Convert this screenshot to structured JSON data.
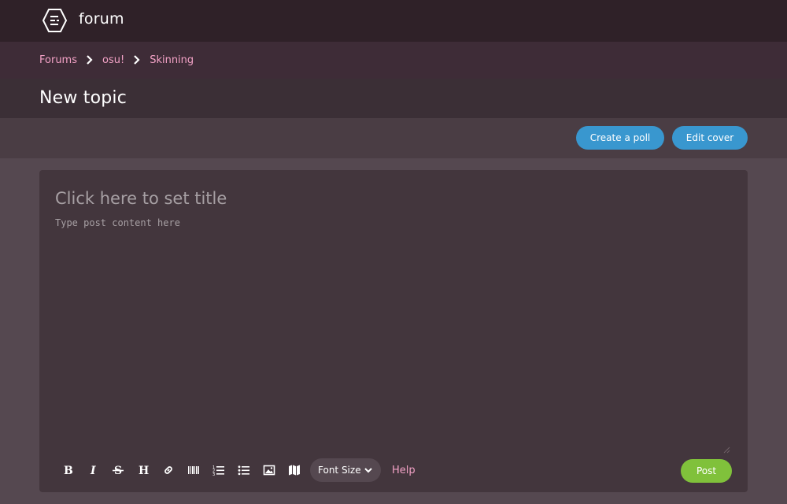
{
  "header": {
    "logo_icon": "osu-forum-hexagon-icon",
    "title": "forum"
  },
  "breadcrumb": {
    "items": [
      {
        "label": "Forums"
      },
      {
        "label": "osu!"
      },
      {
        "label": "Skinning"
      }
    ],
    "separator_icon": "chevron-right-icon"
  },
  "page": {
    "title": "New topic"
  },
  "actions": {
    "create_poll_label": "Create a poll",
    "edit_cover_label": "Edit cover"
  },
  "editor": {
    "title_placeholder": "Click here to set title",
    "title_value": "",
    "body_placeholder": "Type post content here",
    "body_value": ""
  },
  "toolbar": {
    "tools": [
      {
        "name": "bold-icon"
      },
      {
        "name": "italic-icon"
      },
      {
        "name": "strikethrough-icon"
      },
      {
        "name": "heading-icon"
      },
      {
        "name": "link-icon"
      },
      {
        "name": "spoiler-box-icon"
      },
      {
        "name": "ordered-list-icon"
      },
      {
        "name": "unordered-list-icon"
      },
      {
        "name": "image-icon"
      },
      {
        "name": "map-icon"
      }
    ],
    "font_size_label": "Font Size",
    "help_label": "Help",
    "post_label": "Post"
  },
  "colors": {
    "header_bg": "#2f2128",
    "breadcrumb_bg": "#3e2c37",
    "title_bg": "#3b2f36",
    "actions_bg": "#4a3d44",
    "page_bg": "#554850",
    "editor_bg": "#43363d",
    "link_pink": "#f3a2c6",
    "button_blue": "#3997cf",
    "button_green": "#80c13b"
  }
}
